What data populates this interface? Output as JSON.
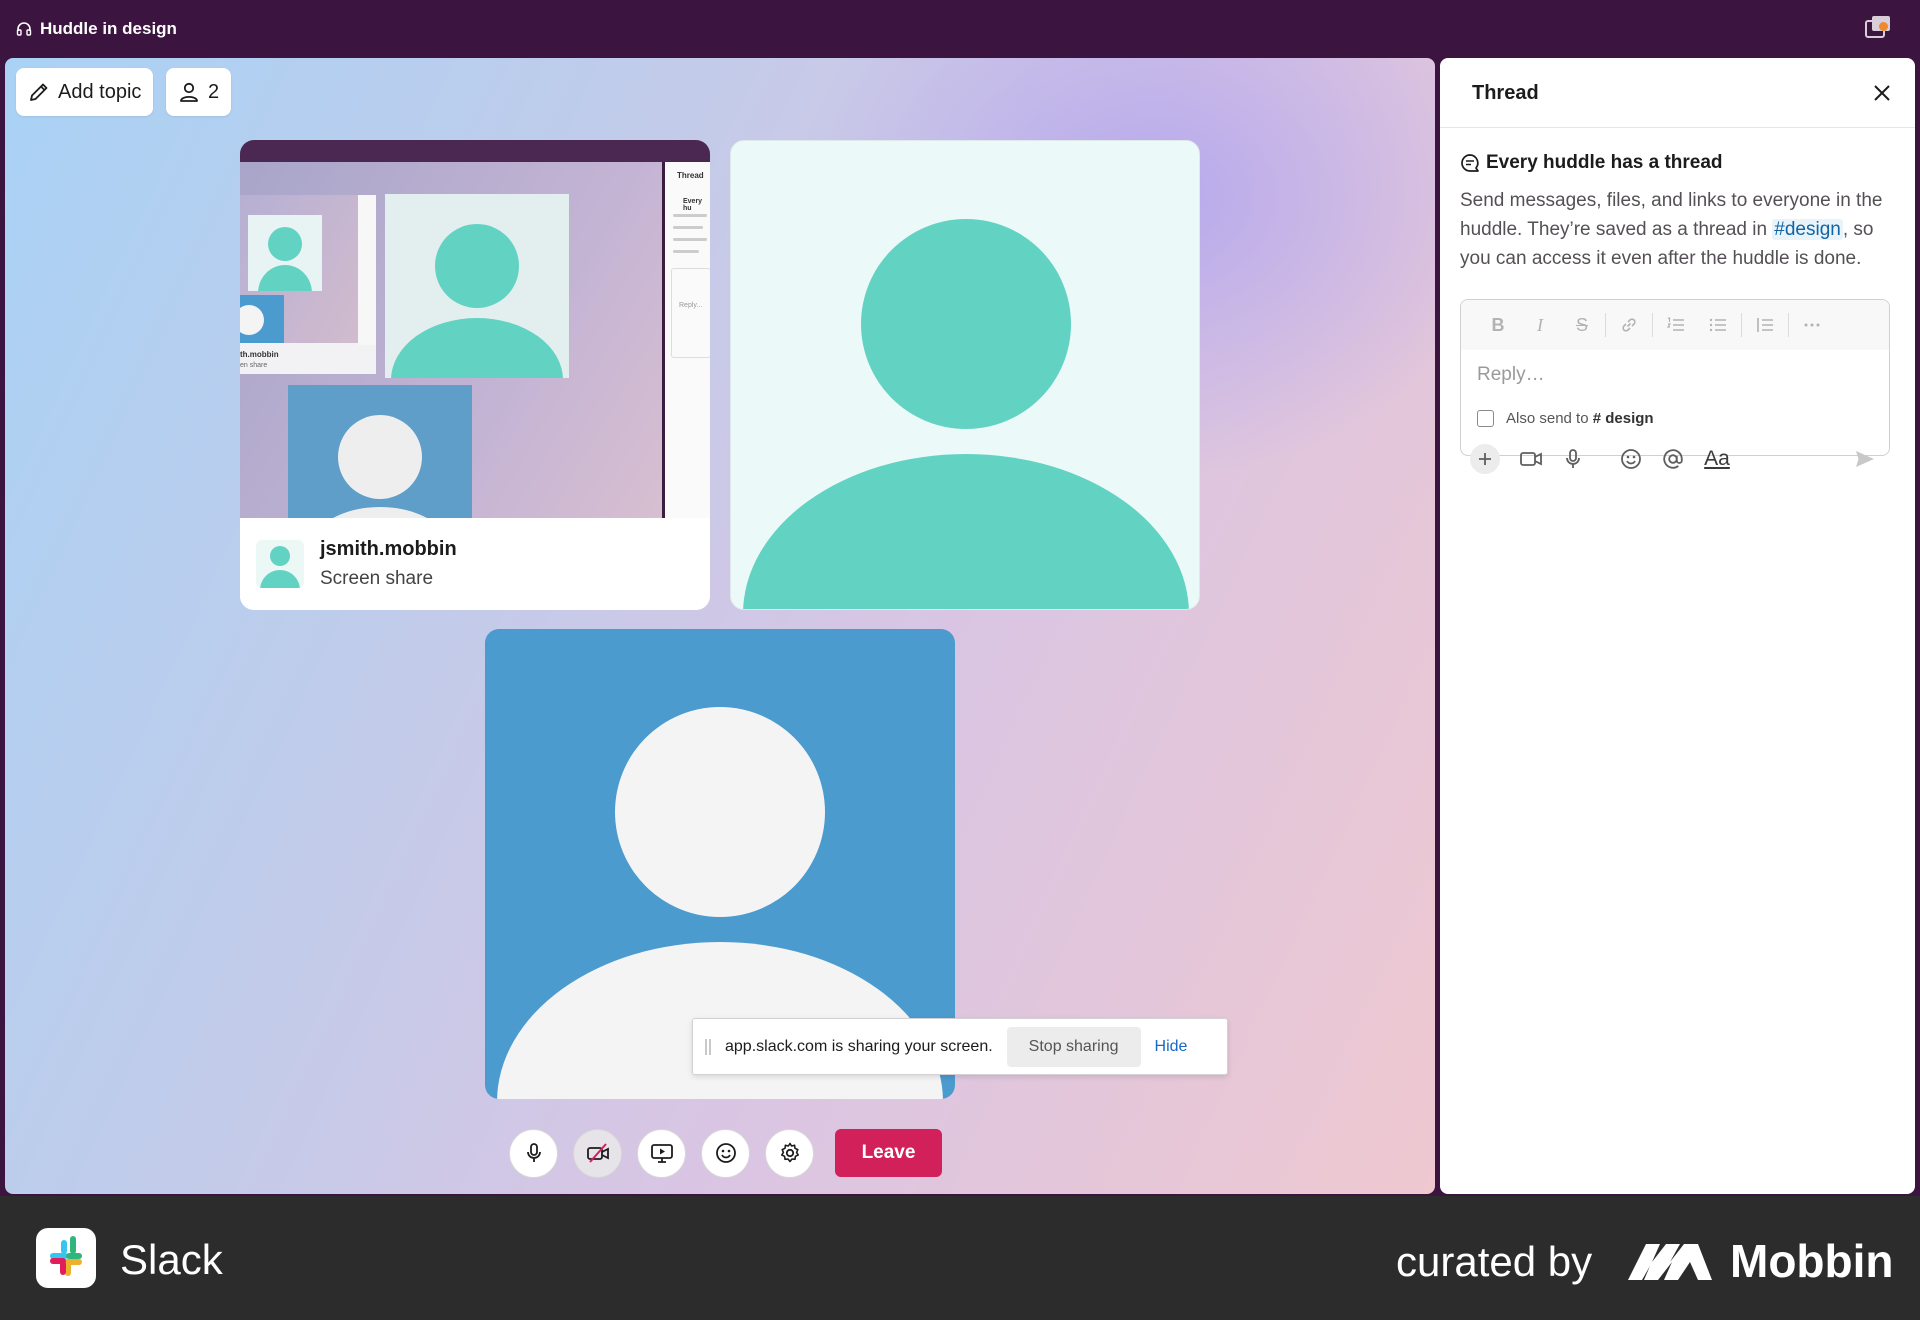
{
  "titlebar": {
    "title": "Huddle in design"
  },
  "stage": {
    "add_topic_label": "Add topic",
    "people_count": "2",
    "screen_share_tile": {
      "name": "jsmith.mobbin",
      "subtitle": "Screen share"
    },
    "share_preview": {
      "thread_label": "Thread",
      "thread_snippet": "Every hu",
      "reply_snippet": "Reply...",
      "name_snippet": "th.mobbin",
      "sub_snippet": "en share"
    },
    "share_notice": {
      "message": "app.slack.com is sharing your screen.",
      "stop_label": "Stop sharing",
      "hide_label": "Hide"
    },
    "controls": {
      "icons": [
        "microphone-icon",
        "video-off-icon",
        "screen-share-icon",
        "emoji-icon",
        "settings-icon"
      ],
      "leave_label": "Leave"
    }
  },
  "thread": {
    "title": "Thread",
    "intro_title": "Every huddle has a thread",
    "intro_body_before": "Send messages, files, and links to everyone in the huddle. They’re saved as a thread in ",
    "channel_link": "#design",
    "intro_body_after": ", so you can access it even after the huddle is done.",
    "composer": {
      "placeholder": "Reply…",
      "also_send_prefix": "Also send to",
      "also_send_channel": "# design",
      "format_icons": [
        "bold",
        "italic",
        "strikethrough",
        "link",
        "numbered-list",
        "bulleted-list",
        "blockquote",
        "more"
      ]
    }
  },
  "footer": {
    "app_name": "Slack",
    "curated_by": "curated by",
    "brand": "Mobbin"
  },
  "colors": {
    "titlebar": "#3b1440",
    "teal_avatar": "#62d2c3",
    "blue_tile": "#4b9bcf",
    "leave": "#d2205a",
    "link": "#1264a3"
  }
}
